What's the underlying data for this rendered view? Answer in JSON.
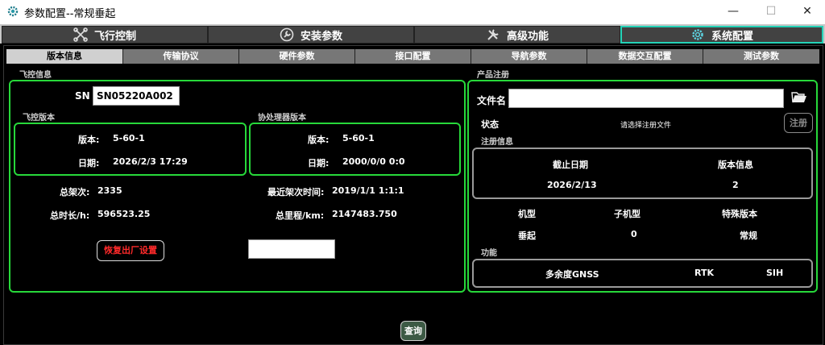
{
  "window": {
    "title": "参数配置--常规垂起",
    "controls": {
      "minimize": "—",
      "maximize": "☐",
      "close": "✕"
    }
  },
  "main_tabs": [
    {
      "label": "飞行控制",
      "icon": "drone-icon"
    },
    {
      "label": "安装参数",
      "icon": "wrench-circle-icon"
    },
    {
      "label": "高级功能",
      "icon": "tools-icon"
    },
    {
      "label": "系统配置",
      "icon": "gear-icon"
    }
  ],
  "sub_tabs": [
    "版本信息",
    "传输协议",
    "硬件参数",
    "接口配置",
    "导航参数",
    "数据交互配置",
    "测试参数"
  ],
  "flight_control": {
    "section_title": "飞控信息",
    "sn_label": "SN",
    "sn_value": "SN05220A002",
    "fc_version": {
      "title": "飞控版本",
      "version_label": "版本:",
      "version_value": "5-60-1",
      "date_label": "日期:",
      "date_value": "2026/2/3 17:29"
    },
    "coprocessor_version": {
      "title": "协处理器版本",
      "version_label": "版本:",
      "version_value": "5-60-1",
      "date_label": "日期:",
      "date_value": "2000/0/0 0:0"
    },
    "total_flights_label": "总架次:",
    "total_flights_value": "2335",
    "total_hours_label": "总时长/h:",
    "total_hours_value": "596523.25",
    "last_flight_label": "最近架次时间:",
    "last_flight_value": "2019/1/1 1:1:1",
    "total_distance_label": "总里程/km:",
    "total_distance_value": "2147483.750",
    "reset_button": "恢复出厂设置",
    "reset_input_value": ""
  },
  "registration": {
    "section_title": "产品注册",
    "file_label": "文件名",
    "file_value": "",
    "folder_icon": "folder-open-icon",
    "status_label": "状态",
    "status_value": "请选择注册文件",
    "register_button": "注册",
    "info_title": "注册信息",
    "expiry_header": "截止日期",
    "version_header": "版本信息",
    "expiry_value": "2026/2/13",
    "version_value": "2",
    "model_header": "机型",
    "submodel_header": "子机型",
    "special_header": "特殊版本",
    "model_value": "垂起",
    "submodel_value": "0",
    "special_value": "常规",
    "features_title": "功能",
    "features": [
      "多余度GNSS",
      "RTK",
      "SIH"
    ]
  },
  "query_button": "查询",
  "colors": {
    "accent_green": "#27d83a",
    "active_tab_border": "#24d3b8",
    "reset_text": "#ff2a2a"
  }
}
